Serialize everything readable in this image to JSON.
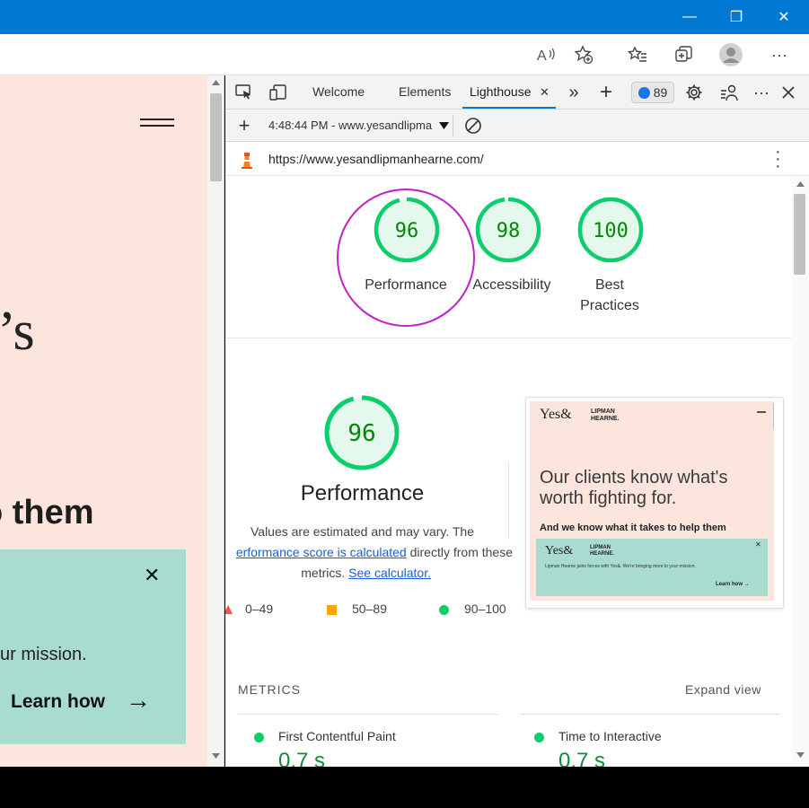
{
  "titlebar": {
    "minimize": "—",
    "restore": "❐",
    "close": "✕"
  },
  "toolbar": {
    "read_aloud": "A",
    "more": "···"
  },
  "website": {
    "hero_fragment": "t’s",
    "bold_fragment": "o them",
    "banner_mission": "ur mission.",
    "banner_learn": "Learn how",
    "banner_close": "✕",
    "banner_arrow": "→"
  },
  "devtools": {
    "tabs": [
      "Welcome",
      "Elements",
      "Lighthouse"
    ],
    "active_tab": "Lighthouse",
    "close_tab": "✕",
    "more_tabs": "»",
    "add_tab": "+",
    "issues_count": "89",
    "report_selector": "4:48:44 PM - www.yesandlipma",
    "url": "https://www.yesandlipmanhearne.com/"
  },
  "scores": [
    {
      "value": "96",
      "label": "Performance",
      "fraction": 0.96
    },
    {
      "value": "98",
      "label": "Accessibility",
      "fraction": 0.98
    },
    {
      "value": "100",
      "label": "Best Practices",
      "fraction": 1.0
    }
  ],
  "performance": {
    "score": "96",
    "fraction": 0.96,
    "title": "Performance",
    "desc_line1": "Values are estimated and may vary. The",
    "desc_link1": "erformance score is calculated",
    "desc_mid": " directly from these",
    "desc_line3": "metrics. ",
    "desc_link2": "See calculator."
  },
  "legend": [
    {
      "range": "0–49",
      "color": "#ff4e42",
      "shape": "triangle"
    },
    {
      "range": "50–89",
      "color": "#ffa400",
      "shape": "square"
    },
    {
      "range": "90–100",
      "color": "#0cce6b",
      "shape": "circle"
    }
  ],
  "screenshot": {
    "logo_yes": "Yes&",
    "logo_lipman": "LIPMAN\nHEARNE.",
    "headline": "Our clients know what's worth fighting for.",
    "subline": "And we know what it takes to help them",
    "inner_logo_yes": "Yes&",
    "inner_logo_lipman": "LIPMAN\nHEARNE.",
    "inner_text": "Lipman Hearne joins forces with Yes&. We're bringing more to your mission.",
    "inner_learn": "Learn how →"
  },
  "metrics": {
    "heading": "METRICS",
    "expand": "Expand view",
    "items": [
      {
        "name": "First Contentful Paint",
        "value": "0.7 s"
      },
      {
        "name": "Time to Interactive",
        "value": "0.7 s"
      }
    ]
  },
  "colors": {
    "pass": "#0cce6b",
    "pass_text": "#008800",
    "gauge_bg": "#e5f8ed",
    "highlight_circle": "#c020c8",
    "accent": "#0078d4"
  }
}
